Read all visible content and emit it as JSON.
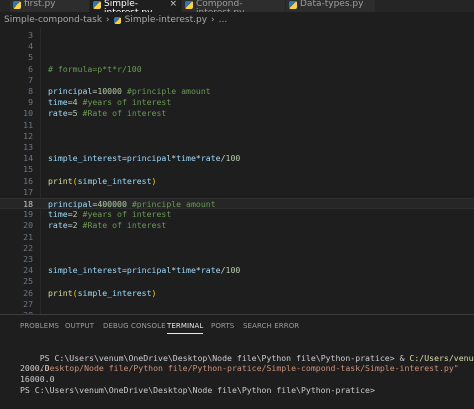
{
  "tabs": [
    {
      "label": "first.py",
      "active": false
    },
    {
      "label": "Simple-interest.py",
      "active": true,
      "close": "×"
    },
    {
      "label": "Compond-interest.py",
      "active": false
    },
    {
      "label": "Data-types.py",
      "active": false
    }
  ],
  "breadcrumb": {
    "folder": "Simple-compond-task",
    "sep1": "›",
    "file": "Simple-interest.py",
    "sep2": "›",
    "more": "..."
  },
  "editor": {
    "current_line": "18",
    "lines": [
      {
        "n": "3",
        "tokens": []
      },
      {
        "n": "4",
        "tokens": []
      },
      {
        "n": "5",
        "tokens": []
      },
      {
        "n": "6",
        "tokens": [
          {
            "t": "# formula=p*t*r/100",
            "c": "com"
          }
        ]
      },
      {
        "n": "7",
        "tokens": []
      },
      {
        "n": "8",
        "tokens": [
          {
            "t": "principal",
            "c": "var"
          },
          {
            "t": "=",
            "c": "op"
          },
          {
            "t": "10000",
            "c": "num"
          },
          {
            "t": " #principle amount",
            "c": "com"
          }
        ]
      },
      {
        "n": "9",
        "tokens": [
          {
            "t": "time",
            "c": "var"
          },
          {
            "t": "=",
            "c": "op"
          },
          {
            "t": "4",
            "c": "num"
          },
          {
            "t": " #years of interest",
            "c": "com"
          }
        ]
      },
      {
        "n": "10",
        "tokens": [
          {
            "t": "rate",
            "c": "var"
          },
          {
            "t": "=",
            "c": "op"
          },
          {
            "t": "5",
            "c": "num"
          },
          {
            "t": " #Rate of interest",
            "c": "com"
          }
        ]
      },
      {
        "n": "11",
        "tokens": []
      },
      {
        "n": "12",
        "tokens": []
      },
      {
        "n": "13",
        "tokens": []
      },
      {
        "n": "14",
        "tokens": [
          {
            "t": "simple_interest",
            "c": "var"
          },
          {
            "t": "=",
            "c": "op"
          },
          {
            "t": "principal",
            "c": "var"
          },
          {
            "t": "*",
            "c": "op"
          },
          {
            "t": "time",
            "c": "var"
          },
          {
            "t": "*",
            "c": "op"
          },
          {
            "t": "rate",
            "c": "var"
          },
          {
            "t": "/",
            "c": "op"
          },
          {
            "t": "100",
            "c": "num"
          }
        ]
      },
      {
        "n": "15",
        "tokens": []
      },
      {
        "n": "16",
        "tokens": [
          {
            "t": "print",
            "c": "fn"
          },
          {
            "t": "(",
            "c": "punc"
          },
          {
            "t": "simple_interest",
            "c": "var"
          },
          {
            "t": ")",
            "c": "punc"
          }
        ]
      },
      {
        "n": "17",
        "tokens": []
      },
      {
        "n": "18",
        "tokens": [
          {
            "t": "principal",
            "c": "var"
          },
          {
            "t": "=",
            "c": "op"
          },
          {
            "t": "400000",
            "c": "num"
          },
          {
            "t": " #principle amount",
            "c": "com"
          }
        ]
      },
      {
        "n": "19",
        "tokens": [
          {
            "t": "time",
            "c": "var"
          },
          {
            "t": "=",
            "c": "op"
          },
          {
            "t": "2",
            "c": "num"
          },
          {
            "t": " #years of interest",
            "c": "com"
          }
        ]
      },
      {
        "n": "20",
        "tokens": [
          {
            "t": "rate",
            "c": "var"
          },
          {
            "t": "=",
            "c": "op"
          },
          {
            "t": "2",
            "c": "num"
          },
          {
            "t": " #Rate of interest",
            "c": "com"
          }
        ]
      },
      {
        "n": "21",
        "tokens": []
      },
      {
        "n": "22",
        "tokens": []
      },
      {
        "n": "23",
        "tokens": []
      },
      {
        "n": "24",
        "tokens": [
          {
            "t": "simple_interest",
            "c": "var"
          },
          {
            "t": "=",
            "c": "op"
          },
          {
            "t": "principal",
            "c": "var"
          },
          {
            "t": "*",
            "c": "op"
          },
          {
            "t": "time",
            "c": "var"
          },
          {
            "t": "*",
            "c": "op"
          },
          {
            "t": "rate",
            "c": "var"
          },
          {
            "t": "/",
            "c": "op"
          },
          {
            "t": "100",
            "c": "num"
          }
        ]
      },
      {
        "n": "25",
        "tokens": []
      },
      {
        "n": "26",
        "tokens": [
          {
            "t": "print",
            "c": "fn"
          },
          {
            "t": "(",
            "c": "punc"
          },
          {
            "t": "simple_interest",
            "c": "var"
          },
          {
            "t": ")",
            "c": "punc"
          }
        ]
      },
      {
        "n": "27",
        "tokens": []
      },
      {
        "n": "28",
        "tokens": []
      }
    ]
  },
  "panel": {
    "tabs": [
      {
        "label": "PROBLEMS",
        "active": false
      },
      {
        "label": "OUTPUT",
        "active": false
      },
      {
        "label": "DEBUG CONSOLE",
        "active": false
      },
      {
        "label": "TERMINAL",
        "active": true
      },
      {
        "label": "PORTS",
        "active": false
      },
      {
        "label": "SEARCH ERROR",
        "active": false
      }
    ]
  },
  "terminal": {
    "prompt1": "PS C:\\Users\\venum\\OneDrive\\Desktop\\Node file\\Python file\\Python-pratice> ",
    "cmd_amp": "& ",
    "cmd_exe": "C:/Users/venum/AppData/Local/Prog",
    "cmd_wrap": "/Desktop/Node file/Python file/Python-pratice/Simple-compond-task/Simple-interest.py\"",
    "out1": "2000.0",
    "out2": "16000.0",
    "prompt2": "PS C:\\Users\\venum\\OneDrive\\Desktop\\Node file\\Python file\\Python-pratice>"
  }
}
